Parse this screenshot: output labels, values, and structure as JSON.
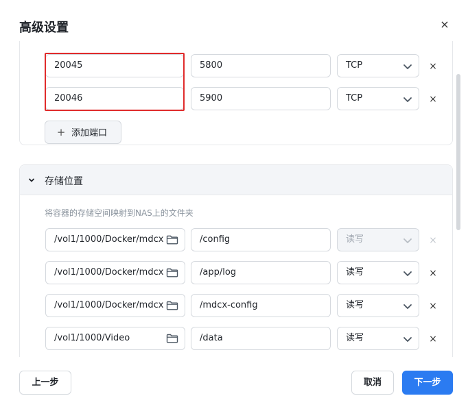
{
  "dialog": {
    "title": "高级设置",
    "close_label": "×"
  },
  "ports": {
    "rows": [
      {
        "host_port": "20045",
        "container_port": "5800",
        "protocol": "TCP",
        "remove": "×"
      },
      {
        "host_port": "20046",
        "container_port": "5900",
        "protocol": "TCP",
        "remove": "×"
      }
    ],
    "add_label": "添加端口",
    "add_icon": "+"
  },
  "storage": {
    "section_title": "存储位置",
    "description": "将容器的存储空间映射到NAS上的文件夹",
    "rows": [
      {
        "host_path": "/vol1/1000/Docker/mdcx",
        "container_path": "/config",
        "mode": "读写",
        "remove": "×",
        "disabled": true
      },
      {
        "host_path": "/vol1/1000/Docker/mdcx",
        "container_path": "/app/log",
        "mode": "读写",
        "remove": "×",
        "disabled": false
      },
      {
        "host_path": "/vol1/1000/Docker/mdcx",
        "container_path": "/mdcx-config",
        "mode": "读写",
        "remove": "×",
        "disabled": false
      },
      {
        "host_path": "/vol1/1000/Video",
        "container_path": "/data",
        "mode": "读写",
        "remove": "×",
        "disabled": false
      }
    ]
  },
  "footer": {
    "prev_label": "上一步",
    "cancel_label": "取消",
    "next_label": "下一步"
  },
  "colors": {
    "primary": "#2b7bf1",
    "highlight": "#e02b2b"
  }
}
